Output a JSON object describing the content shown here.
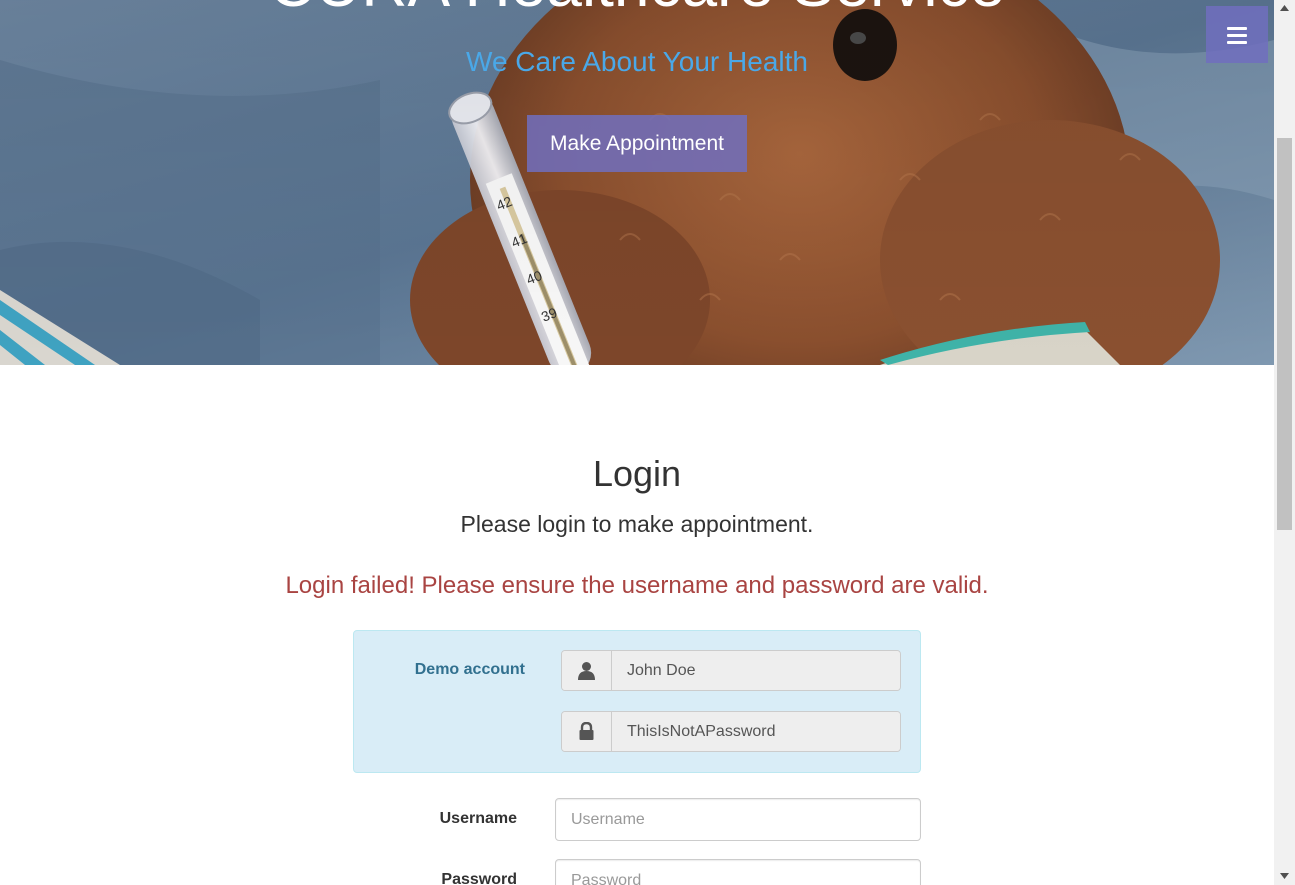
{
  "hero": {
    "title": "CURA Healthcare Service",
    "subtitle": "We Care About Your Health",
    "appointment_button": "Make Appointment",
    "menu_icon": "bars-icon",
    "background_image": "teddy-bear-with-thermometer",
    "colors": {
      "subtitle": "#4aa8e8",
      "button": "#706ebe"
    }
  },
  "login": {
    "title": "Login",
    "lead": "Please login to make appointment.",
    "error": "Login failed! Please ensure the username and password are valid.",
    "error_color": "#a94442",
    "demo": {
      "label": "Demo account",
      "username_icon": "user-icon",
      "username_value": "John Doe",
      "password_icon": "lock-icon",
      "password_value": "ThisIsNotAPassword"
    },
    "username": {
      "label": "Username",
      "placeholder": "Username",
      "value": ""
    },
    "password": {
      "label": "Password",
      "placeholder": "Password",
      "value": ""
    }
  },
  "scrollbar": {
    "up_icon": "triangle-up-icon",
    "down_icon": "triangle-down-icon"
  }
}
